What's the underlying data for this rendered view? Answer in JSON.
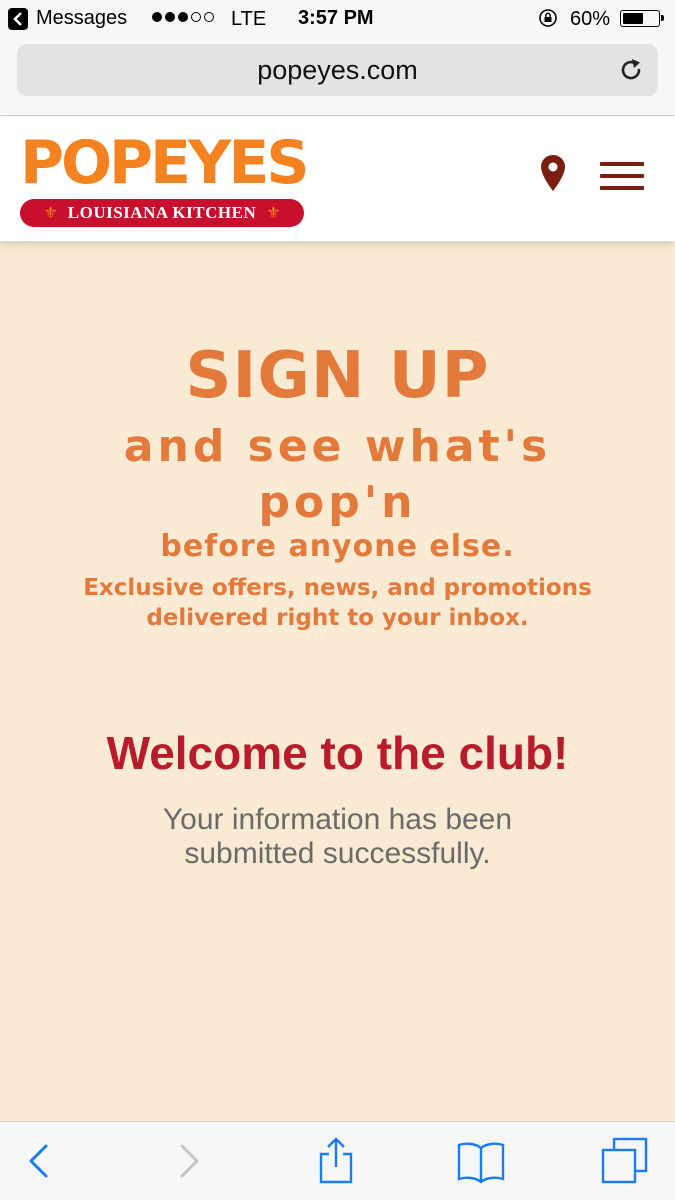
{
  "status_bar": {
    "back_app": "Messages",
    "carrier": "LTE",
    "time": "3:57 PM",
    "battery_percent": "60%",
    "battery_level": 0.6,
    "signal_bars": 3
  },
  "address_bar": {
    "url": "popeyes.com"
  },
  "header": {
    "logo_word": "POPEYES",
    "logo_tagline": "LOUISIANA KITCHEN",
    "icons": [
      "location-pin-icon",
      "hamburger-menu-icon"
    ]
  },
  "main": {
    "heading": "SIGN UP",
    "subheading_line1": "and see what's",
    "subheading_line2": "pop'n",
    "subheading_line3": "before anyone else.",
    "promo_line1": "Exclusive offers, news, and promotions",
    "promo_line2": "delivered right to your inbox.",
    "welcome": "Welcome to the club!",
    "submitted_line1": "Your information has been",
    "submitted_line2": "submitted successfully."
  },
  "toolbar": {
    "icons": [
      "back-icon",
      "forward-icon",
      "share-icon",
      "bookmarks-icon",
      "tabs-icon"
    ]
  },
  "colors": {
    "orange": "#e3793a",
    "red": "#b81c2b",
    "background": "#f9ead3",
    "link_blue": "#1a7cf5"
  }
}
